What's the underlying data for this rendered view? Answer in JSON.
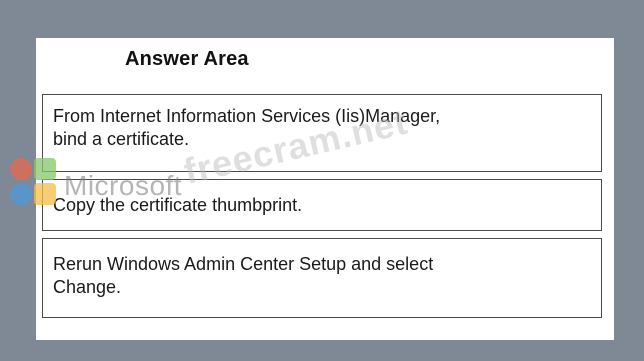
{
  "answer_area": {
    "title": "Answer Area",
    "items": [
      {
        "text_line1": "From Internet Information Services (Iis)Manager,",
        "text_line2": "bind a certificate."
      },
      {
        "text_line1": "Copy the certificate thumbprint."
      },
      {
        "text_line1": "Rerun Windows Admin Center Setup and select",
        "text_line2": "Change."
      }
    ]
  },
  "watermarks": {
    "vendor": "Microsoft",
    "site": "freecram.net"
  },
  "colors": {
    "background": "#7f8895",
    "panel": "#ffffff",
    "border": "#4a4a4a"
  }
}
